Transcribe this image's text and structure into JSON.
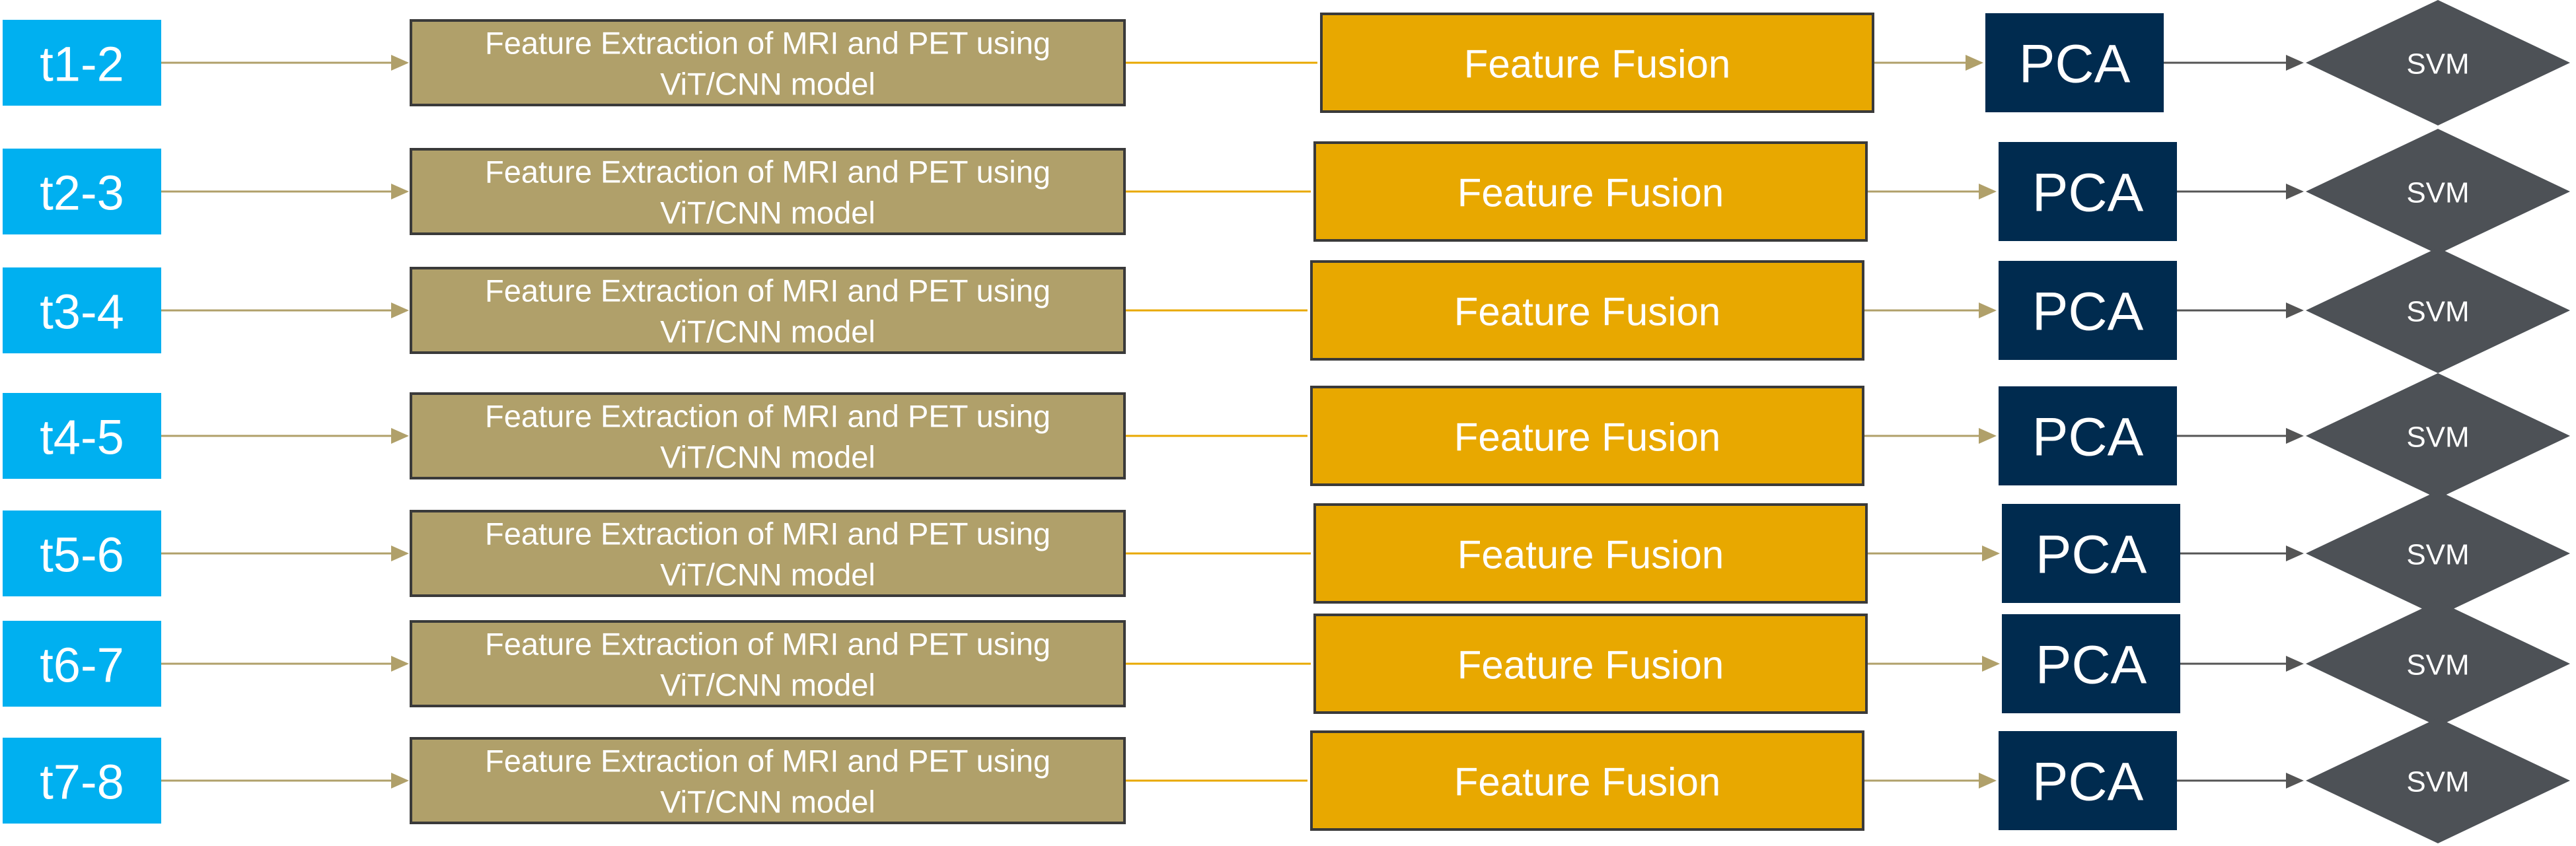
{
  "diagram": {
    "colors": {
      "time_box": "#00B0F0",
      "extraction_box": "#B0A06A",
      "extraction_border": "#3A3A3A",
      "fusion_box": "#E8A800",
      "fusion_border": "#3A3A3A",
      "pca_box": "#002B4F",
      "svm_diamond": "#4D5156",
      "arrow_tan": "#B0A06A",
      "arrow_gold": "#E8A800",
      "arrow_grey": "#555555",
      "text": "#FFFFFF"
    },
    "rows": [
      {
        "time_label": "t1-2",
        "extraction_line1": "Feature Extraction of MRI and PET using",
        "extraction_line2": "ViT/CNN model",
        "fusion_label": "Feature Fusion",
        "pca_label": "PCA",
        "svm_label": "SVM"
      },
      {
        "time_label": "t2-3",
        "extraction_line1": "Feature Extraction of MRI and PET using",
        "extraction_line2": "ViT/CNN model",
        "fusion_label": "Feature Fusion",
        "pca_label": "PCA",
        "svm_label": "SVM"
      },
      {
        "time_label": "t3-4",
        "extraction_line1": "Feature Extraction of MRI and PET using",
        "extraction_line2": "ViT/CNN model",
        "fusion_label": "Feature Fusion",
        "pca_label": "PCA",
        "svm_label": "SVM"
      },
      {
        "time_label": "t4-5",
        "extraction_line1": "Feature Extraction of MRI and PET using",
        "extraction_line2": "ViT/CNN model",
        "fusion_label": "Feature Fusion",
        "pca_label": "PCA",
        "svm_label": "SVM"
      },
      {
        "time_label": "t5-6",
        "extraction_line1": "Feature Extraction of MRI and PET using",
        "extraction_line2": "ViT/CNN model",
        "fusion_label": "Feature Fusion",
        "pca_label": "PCA",
        "svm_label": "SVM"
      },
      {
        "time_label": "t6-7",
        "extraction_line1": "Feature Extraction of MRI and PET using",
        "extraction_line2": "ViT/CNN model",
        "fusion_label": "Feature Fusion",
        "pca_label": "PCA",
        "svm_label": "SVM"
      },
      {
        "time_label": "t7-8",
        "extraction_line1": "Feature Extraction of MRI and PET using",
        "extraction_line2": "ViT/CNN model",
        "fusion_label": "Feature Fusion",
        "pca_label": "PCA",
        "svm_label": "SVM"
      }
    ]
  }
}
